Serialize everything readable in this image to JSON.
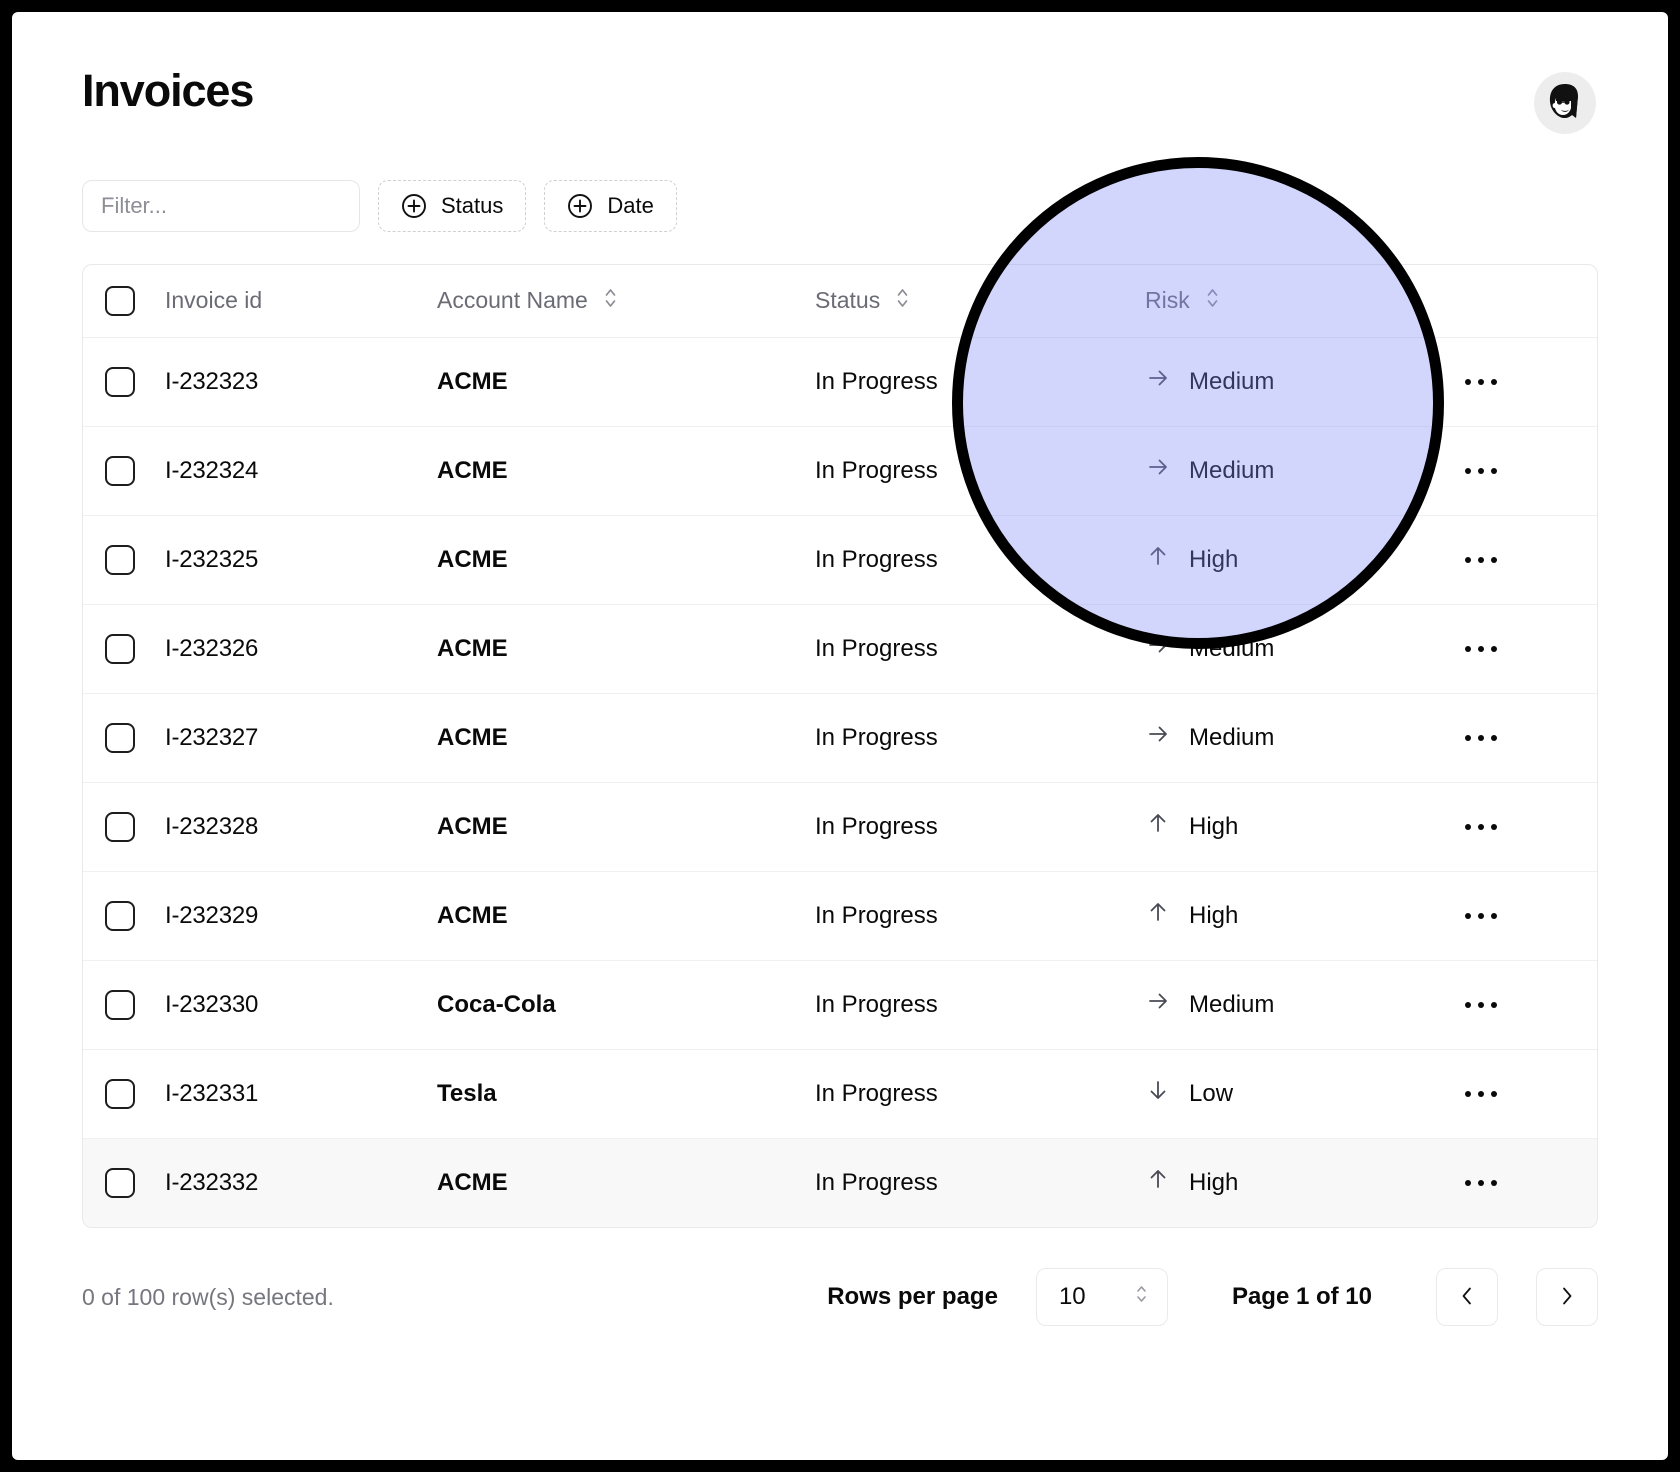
{
  "window": {
    "frame_color": "#000000",
    "surface_color": "#ffffff"
  },
  "header": {
    "title": "Invoices",
    "avatar_alt": "user-avatar"
  },
  "toolbar": {
    "filter_placeholder": "Filter...",
    "filter_value": "",
    "facets": [
      {
        "label": "Status",
        "icon": "plus-circle-icon"
      },
      {
        "label": "Date",
        "icon": "plus-circle-icon"
      }
    ]
  },
  "table": {
    "select_all_checked": false,
    "columns": [
      {
        "key": "check",
        "label": "",
        "sortable": false
      },
      {
        "key": "id",
        "label": "Invoice id",
        "sortable": false
      },
      {
        "key": "acct",
        "label": "Account Name",
        "sortable": true
      },
      {
        "key": "status",
        "label": "Status",
        "sortable": true
      },
      {
        "key": "risk",
        "label": "Risk",
        "sortable": true
      },
      {
        "key": "menu",
        "label": "",
        "sortable": false
      }
    ],
    "rows": [
      {
        "id": "I-232323",
        "account": "ACME",
        "status": "In Progress",
        "risk": "Medium",
        "risk_icon": "arrow-right-icon",
        "selected": false,
        "highlighted": false
      },
      {
        "id": "I-232324",
        "account": "ACME",
        "status": "In Progress",
        "risk": "Medium",
        "risk_icon": "arrow-right-icon",
        "selected": false,
        "highlighted": false
      },
      {
        "id": "I-232325",
        "account": "ACME",
        "status": "In Progress",
        "risk": "High",
        "risk_icon": "arrow-up-icon",
        "selected": false,
        "highlighted": false
      },
      {
        "id": "I-232326",
        "account": "ACME",
        "status": "In Progress",
        "risk": "Medium",
        "risk_icon": "arrow-right-icon",
        "selected": false,
        "highlighted": false
      },
      {
        "id": "I-232327",
        "account": "ACME",
        "status": "In Progress",
        "risk": "Medium",
        "risk_icon": "arrow-right-icon",
        "selected": false,
        "highlighted": false
      },
      {
        "id": "I-232328",
        "account": "ACME",
        "status": "In Progress",
        "risk": "High",
        "risk_icon": "arrow-up-icon",
        "selected": false,
        "highlighted": false
      },
      {
        "id": "I-232329",
        "account": "ACME",
        "status": "In Progress",
        "risk": "High",
        "risk_icon": "arrow-up-icon",
        "selected": false,
        "highlighted": false
      },
      {
        "id": "I-232330",
        "account": "Coca-Cola",
        "status": "In Progress",
        "risk": "Medium",
        "risk_icon": "arrow-right-icon",
        "selected": false,
        "highlighted": false
      },
      {
        "id": "I-232331",
        "account": "Tesla",
        "status": "In Progress",
        "risk": "Low",
        "risk_icon": "arrow-down-icon",
        "selected": false,
        "highlighted": false
      },
      {
        "id": "I-232332",
        "account": "ACME",
        "status": "In Progress",
        "risk": "High",
        "risk_icon": "arrow-up-icon",
        "selected": false,
        "highlighted": true
      }
    ],
    "row_menu_icon": "ellipsis-horizontal-icon"
  },
  "footer": {
    "rows_selected_text": "0 of 100 row(s) selected.",
    "rows_per_page_label": "Rows per page",
    "rows_per_page_value": "10",
    "page_indicator": "Page 1 of 10",
    "prev_icon": "chevron-left-icon",
    "next_icon": "chevron-right-icon"
  },
  "overlay": {
    "type": "magnifier-circle",
    "fill_color": "#c0c5f5",
    "stroke_color": "#000000"
  }
}
